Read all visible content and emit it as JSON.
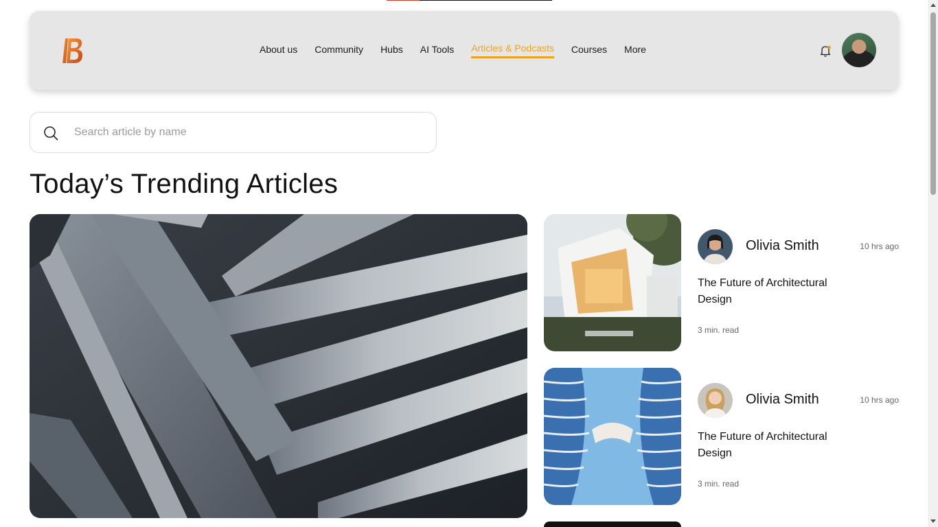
{
  "header": {
    "logo_text": "B",
    "nav": [
      {
        "label": "About us"
      },
      {
        "label": "Community"
      },
      {
        "label": "Hubs"
      },
      {
        "label": "AI Tools"
      },
      {
        "label": "Articles & Podcasts",
        "active": true
      },
      {
        "label": "Courses"
      },
      {
        "label": "More"
      }
    ],
    "accent_color": "#f0a21a",
    "icons": {
      "notification": "bell-icon",
      "notification_dot_color": "#f0a21a",
      "user": "user-avatar"
    }
  },
  "search": {
    "placeholder": "Search article by name",
    "value": "",
    "icon": "search-icon"
  },
  "main": {
    "title": "Today’s Trending Articles",
    "articles": [
      {
        "author": "Olivia Smith",
        "time_ago": "10 hrs ago",
        "title": "The Future of Architectural Design",
        "read_time": "3 min. read"
      },
      {
        "author": "Olivia Smith",
        "time_ago": "10 hrs ago",
        "title": "The Future of Architectural Design",
        "read_time": "3 min. read"
      }
    ]
  }
}
